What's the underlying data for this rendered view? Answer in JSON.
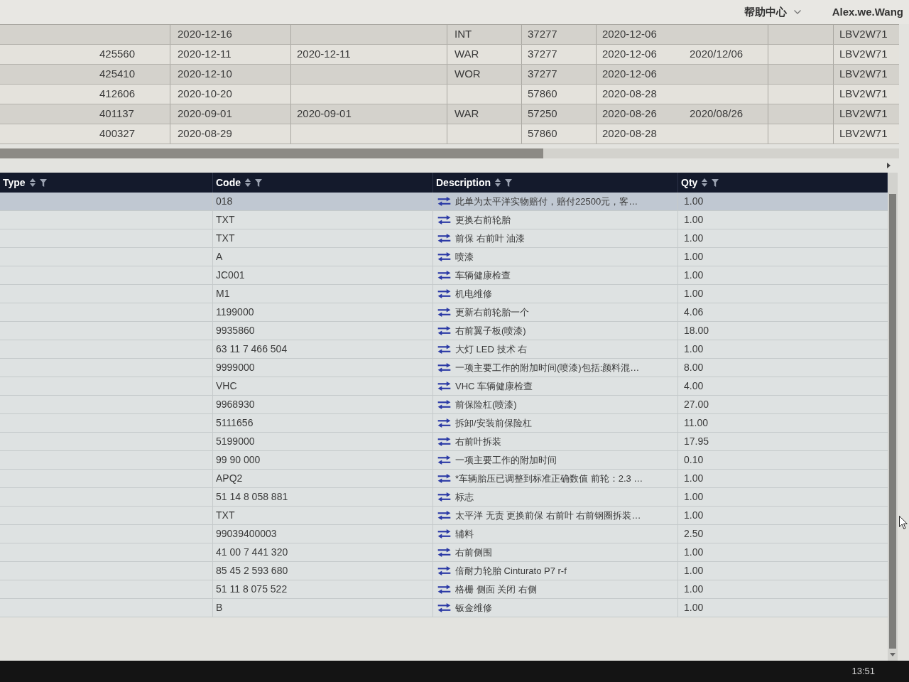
{
  "top_bar": {
    "help_menu": "帮助中心",
    "user": "Alex.we.Wang"
  },
  "upper_table": {
    "rows": [
      {
        "column_2": "2020-12-16",
        "column_4": "INT",
        "column_5": "37277",
        "column_6": "2020-12-06",
        "column_9": "LBV2W71"
      },
      {
        "column_1": "425560",
        "column_2": "2020-12-11",
        "column_3": "2020-12-11",
        "column_4": "WAR",
        "column_5": "37277",
        "column_6": "2020-12-06",
        "column_7": "2020/12/06",
        "column_9": "LBV2W71"
      },
      {
        "column_1": "425410",
        "column_2": "2020-12-10",
        "column_4": "WOR",
        "column_5": "37277",
        "column_6": "2020-12-06",
        "column_9": "LBV2W71"
      },
      {
        "column_1": "412606",
        "column_2": "2020-10-20",
        "column_5": "57860",
        "column_6": "2020-08-28",
        "column_9": "LBV2W71"
      },
      {
        "column_1": "401137",
        "column_2": "2020-09-01",
        "column_3": "2020-09-01",
        "column_4": "WAR",
        "column_5": "57250",
        "column_6": "2020-08-26",
        "column_7": "2020/08/26",
        "column_9": "LBV2W71"
      },
      {
        "column_1": "400327",
        "column_2": "2020-08-29",
        "column_5": "57860",
        "column_6": "2020-08-28",
        "column_9": "LBV2W71"
      }
    ]
  },
  "lower_table": {
    "columns": [
      {
        "label": "Type"
      },
      {
        "label": "Code"
      },
      {
        "label": "Description"
      },
      {
        "label": "Qty"
      }
    ],
    "rows": [
      {
        "code": "018",
        "description": "此单为太平洋实物赔付，赔付22500元，客…",
        "qty": "1.00",
        "selected": true
      },
      {
        "code": "TXT",
        "description": "更换右前轮胎",
        "qty": "1.00",
        "selected": false
      },
      {
        "code": "TXT",
        "description": "前保 右前叶 油漆",
        "qty": "1.00",
        "selected": false
      },
      {
        "code": "A",
        "description": "喷漆",
        "qty": "1.00",
        "selected": false
      },
      {
        "code": "JC001",
        "description": "车辆健康检查",
        "qty": "1.00",
        "selected": false
      },
      {
        "code": "M1",
        "description": "机电维修",
        "qty": "1.00",
        "selected": false
      },
      {
        "code": "1199000",
        "description": "更新右前轮胎一个",
        "qty": "4.06",
        "selected": false
      },
      {
        "code": "9935860",
        "description": "右前翼子板(喷漆)",
        "qty": "18.00",
        "selected": false
      },
      {
        "code": "63 11 7 466 504",
        "description": "大灯 LED 技术 右",
        "qty": "1.00",
        "selected": false
      },
      {
        "code": "9999000",
        "description": "一项主要工作的附加时间(喷漆)包括:颜料混…",
        "qty": "8.00",
        "selected": false
      },
      {
        "code": "VHC",
        "description": "VHC 车辆健康检查",
        "qty": "4.00",
        "selected": false
      },
      {
        "code": "9968930",
        "description": "前保险杠(喷漆)",
        "qty": "27.00",
        "selected": false
      },
      {
        "code": "5111656",
        "description": "拆卸/安装前保险杠",
        "qty": "11.00",
        "selected": false
      },
      {
        "code": "5199000",
        "description": "右前叶拆装",
        "qty": "17.95",
        "selected": false
      },
      {
        "code": "99 90 000",
        "description": "一项主要工作的附加时间",
        "qty": "0.10",
        "selected": false
      },
      {
        "code": "APQ2",
        "description": "*车辆胎压已调整到标准正确数值 前轮：2.3 …",
        "qty": "1.00",
        "selected": false
      },
      {
        "code": "51 14 8 058 881",
        "description": "标志",
        "qty": "1.00",
        "selected": false
      },
      {
        "code": "TXT",
        "description": "太平洋 无责 更换前保 右前叶 右前钢圈拆装…",
        "qty": "1.00",
        "selected": false
      },
      {
        "code": "99039400003",
        "description": "辅料",
        "qty": "2.50",
        "selected": false
      },
      {
        "code": "41 00 7 441 320",
        "description": "右前侧围",
        "qty": "1.00",
        "selected": false
      },
      {
        "code": "85 45 2 593 680",
        "description": "倍耐力轮胎 Cinturato P7 r-f",
        "qty": "1.00",
        "selected": false
      },
      {
        "code": "51 11 8 075 522",
        "description": "格栅 侧面 关闭 右侧",
        "qty": "1.00",
        "selected": false
      },
      {
        "code": "B",
        "description": "钣金维修",
        "qty": "1.00",
        "selected": false
      }
    ]
  },
  "taskbar": {
    "clock": "13:51"
  }
}
